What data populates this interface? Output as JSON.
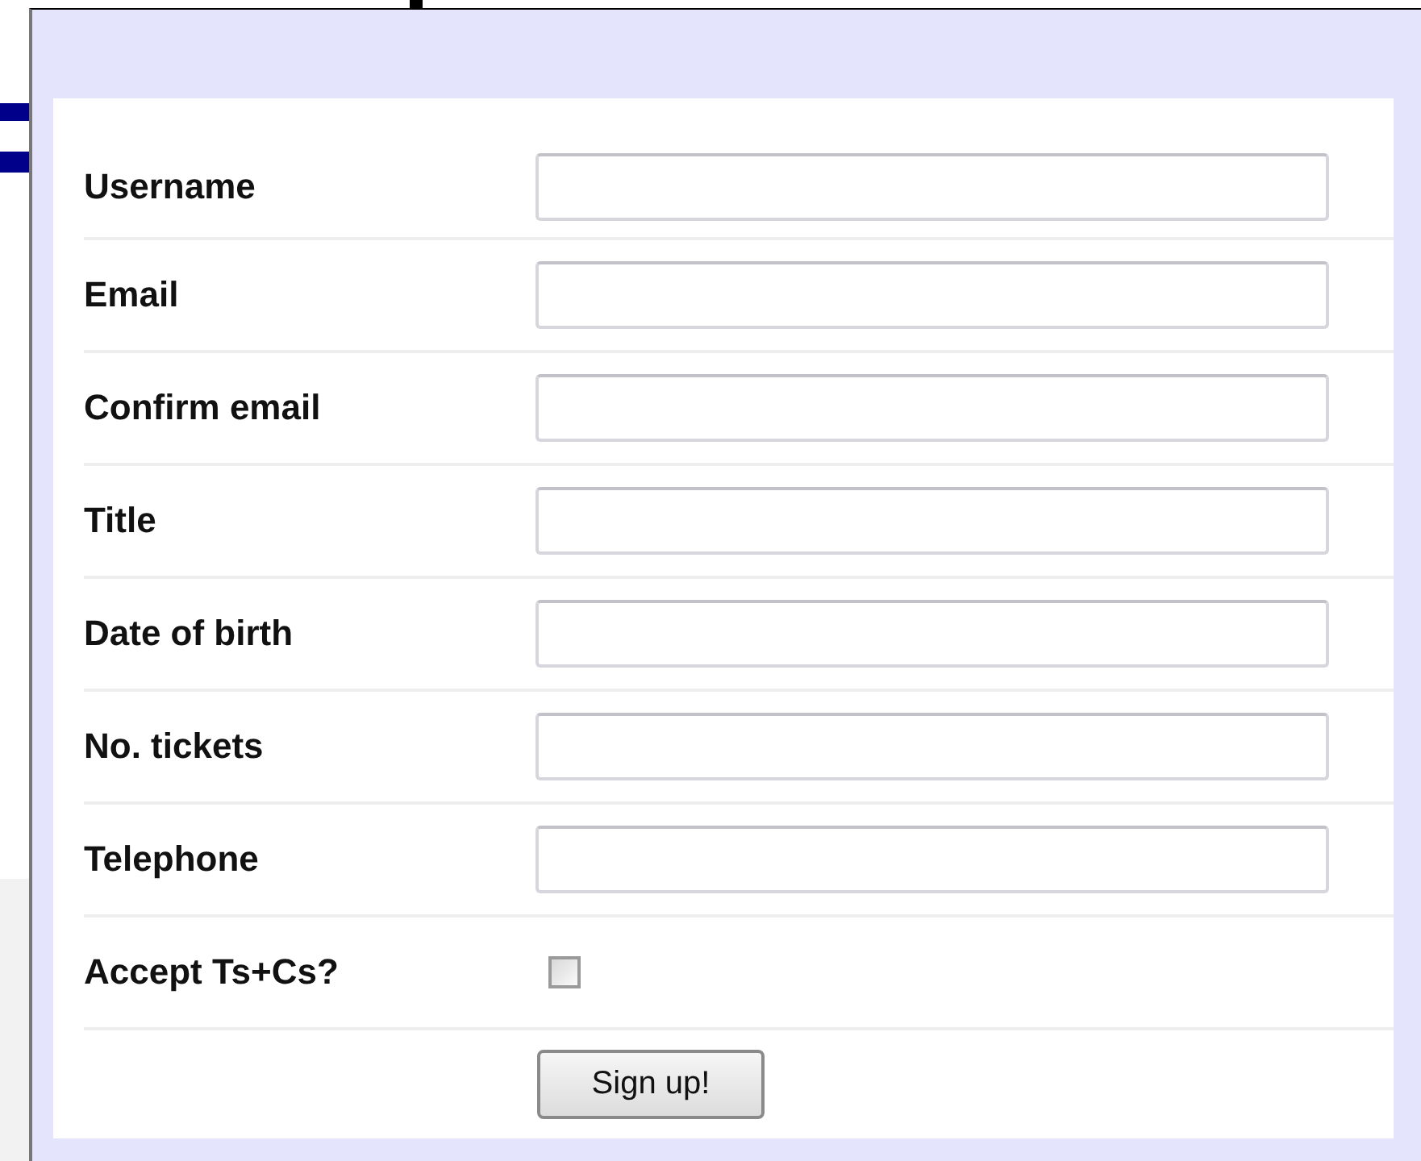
{
  "form": {
    "fields": [
      {
        "label": "Username",
        "kind": "text"
      },
      {
        "label": "Email",
        "kind": "text"
      },
      {
        "label": "Confirm email",
        "kind": "text"
      },
      {
        "label": "Title",
        "kind": "text"
      },
      {
        "label": "Date of birth",
        "kind": "text"
      },
      {
        "label": "No. tickets",
        "kind": "text"
      },
      {
        "label": "Telephone",
        "kind": "text"
      },
      {
        "label": "Accept Ts+Cs?",
        "kind": "checkbox",
        "checked": false
      }
    ],
    "submit": "Sign up!"
  }
}
